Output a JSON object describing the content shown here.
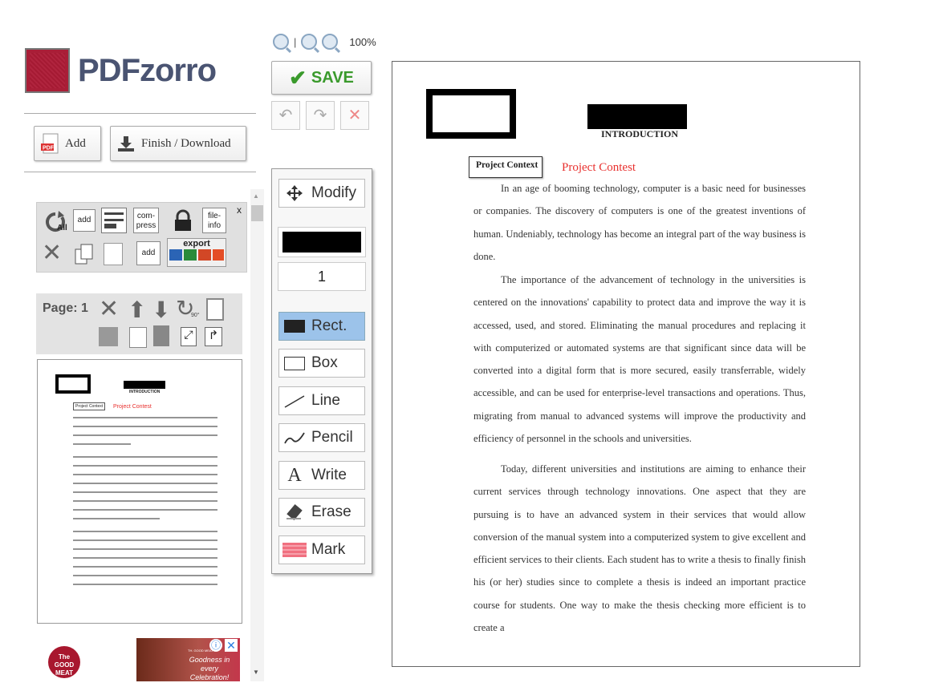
{
  "brand": {
    "name": "PDFzorro"
  },
  "actions": {
    "add_label": "Add",
    "finish_label": "Finish / Download"
  },
  "tools_panel": {
    "close": "x",
    "icons": {
      "all": "All",
      "add": "add",
      "compress": "com-press",
      "fileinfo": "file-info",
      "add2": "add",
      "export": "export"
    }
  },
  "page_panel": {
    "label": "Page: 1",
    "rotate_badge": "90°"
  },
  "zoom": {
    "level": "100%"
  },
  "save": {
    "label": "SAVE"
  },
  "tools": {
    "modify": "Modify",
    "color_value": "#000000",
    "stroke_width": "1",
    "rect": "Rect.",
    "box": "Box",
    "line": "Line",
    "pencil": "Pencil",
    "write": "Write",
    "erase": "Erase",
    "mark": "Mark"
  },
  "document": {
    "heading": "INTRODUCTION",
    "box_label": "Project Context",
    "red_text": "Project Contest",
    "paragraphs": [
      "In an age of booming technology, computer is a basic need for businesses or companies. The discovery of computers is one of the greatest inventions of human. Undeniably, technology has become an integral part of the way business is done.",
      "The importance of the advancement of technology in the universities is centered on the innovations' capability to protect data and improve the way it is accessed, used, and stored. Eliminating the manual procedures and replacing it with computerized or automated systems are that significant since data will be converted into a digital form that is more secured, easily transferrable, widely accessible, and can be used for enterprise-level transactions and operations. Thus, migrating from manual to advanced systems will improve the productivity and efficiency of personnel in the schools and universities.",
      "Today, different universities and institutions are aiming to enhance their current services through technology innovations. One aspect that they are pursuing is to have an advanced system in their services that would allow conversion of the manual system into a computerized system to give excellent and efficient services to their clients. Each student has to write a thesis to finally finish his (or her) studies since to complete a thesis is indeed an important practice course for students. One way to make the thesis checking more efficient is to create a"
    ]
  },
  "ad": {
    "brand": "The GOOD MEAT",
    "tagline": "Goodness in every Celebration!",
    "small": "TH. GOOD MEAT"
  },
  "colors": {
    "brand": "#4a5472",
    "logo_red": "#a91e37",
    "save_green": "#3a9a2c",
    "active_tool": "#9cc3ea",
    "red_text": "#e8302e"
  }
}
